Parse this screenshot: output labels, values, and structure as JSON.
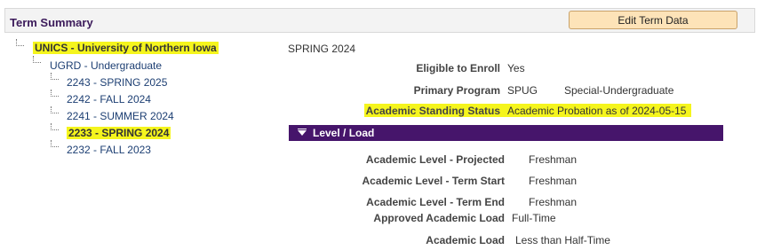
{
  "header": {
    "title": "Term Summary",
    "edit_button_label": "Edit Term Data"
  },
  "tree": {
    "institution": "UNICS - University of Northern Iowa",
    "career": "UGRD - Undergraduate",
    "terms": [
      {
        "label": "2243 - SPRING 2025",
        "selected": false
      },
      {
        "label": "2242 - FALL 2024",
        "selected": false
      },
      {
        "label": "2241 - SUMMER 2024",
        "selected": false
      },
      {
        "label": "2233 - SPRING 2024",
        "selected": true
      },
      {
        "label": "2232 - FALL 2023",
        "selected": false
      }
    ]
  },
  "summary": {
    "term": "SPRING 2024",
    "eligible_label": "Eligible to Enroll",
    "eligible_value": "Yes",
    "program_label": "Primary Program",
    "program_code": "SPUG",
    "program_desc": "Special-Undergraduate",
    "standing_label": "Academic Standing Status",
    "standing_value": "Academic Probation as of 2024-05-15"
  },
  "level_load": {
    "section_title": "Level / Load",
    "level_projected_label": "Academic Level - Projected",
    "level_projected_value": "Freshman",
    "level_start_label": "Academic Level - Term Start",
    "level_start_value": "Freshman",
    "level_end_label": "Academic Level - Term End",
    "level_end_value": "Freshman",
    "approved_load_label": "Approved Academic Load",
    "approved_load_value": "Full-Time",
    "load_label": "Academic Load",
    "load_value": "Less than Half-Time"
  },
  "colors": {
    "accent_purple": "#46156b",
    "highlight_yellow": "#f5f51d",
    "button_bg": "#fde3b8",
    "link_blue": "#1d3f73"
  }
}
